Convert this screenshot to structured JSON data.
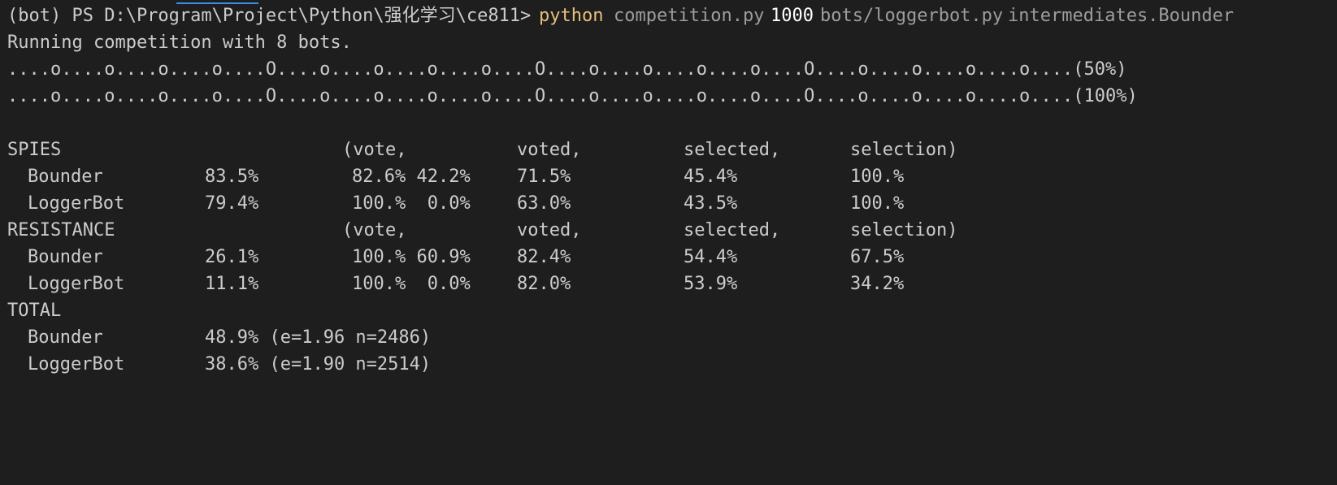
{
  "prompt": {
    "text": "(bot) PS D:\\Program\\Project\\Python\\强化学习\\ce811>",
    "command": "python",
    "script": "competition.py",
    "count": "1000",
    "bot_file": "bots/loggerbot.py",
    "opponent": "intermediates.Bounder"
  },
  "running_line": "Running competition with 8 bots.",
  "progress": [
    "....o....o....o....o....O....o....o....o....o....O....o....o....o....o....O....o....o....o....o....(50%)",
    "....o....o....o....o....O....o....o....o....o....O....o....o....o....o....O....o....o....o....o....(100%)"
  ],
  "columns": {
    "vote": "(vote,",
    "voted": "voted,",
    "selected": "selected,",
    "selection": "selection)"
  },
  "spies": {
    "header": "SPIES",
    "rows": [
      {
        "name": "Bounder",
        "pct": "83.5%",
        "vote": "82.6% 42.2%",
        "voted": "71.5%",
        "selected": "45.4%",
        "selection": "100.%"
      },
      {
        "name": "LoggerBot",
        "pct": "79.4%",
        "vote": "100.%  0.0%",
        "voted": "63.0%",
        "selected": "43.5%",
        "selection": "100.%"
      }
    ]
  },
  "resistance": {
    "header": "RESISTANCE",
    "rows": [
      {
        "name": "Bounder",
        "pct": "26.1%",
        "vote": "100.% 60.9%",
        "voted": "82.4%",
        "selected": "54.4%",
        "selection": "67.5%"
      },
      {
        "name": "LoggerBot",
        "pct": "11.1%",
        "vote": "100.%  0.0%",
        "voted": "82.0%",
        "selected": "53.9%",
        "selection": "34.2%"
      }
    ]
  },
  "total": {
    "header": "TOTAL",
    "rows": [
      {
        "name": "Bounder",
        "summary": "48.9% (e=1.96 n=2486)"
      },
      {
        "name": "LoggerBot",
        "summary": "38.6% (e=1.90 n=2514)"
      }
    ]
  }
}
